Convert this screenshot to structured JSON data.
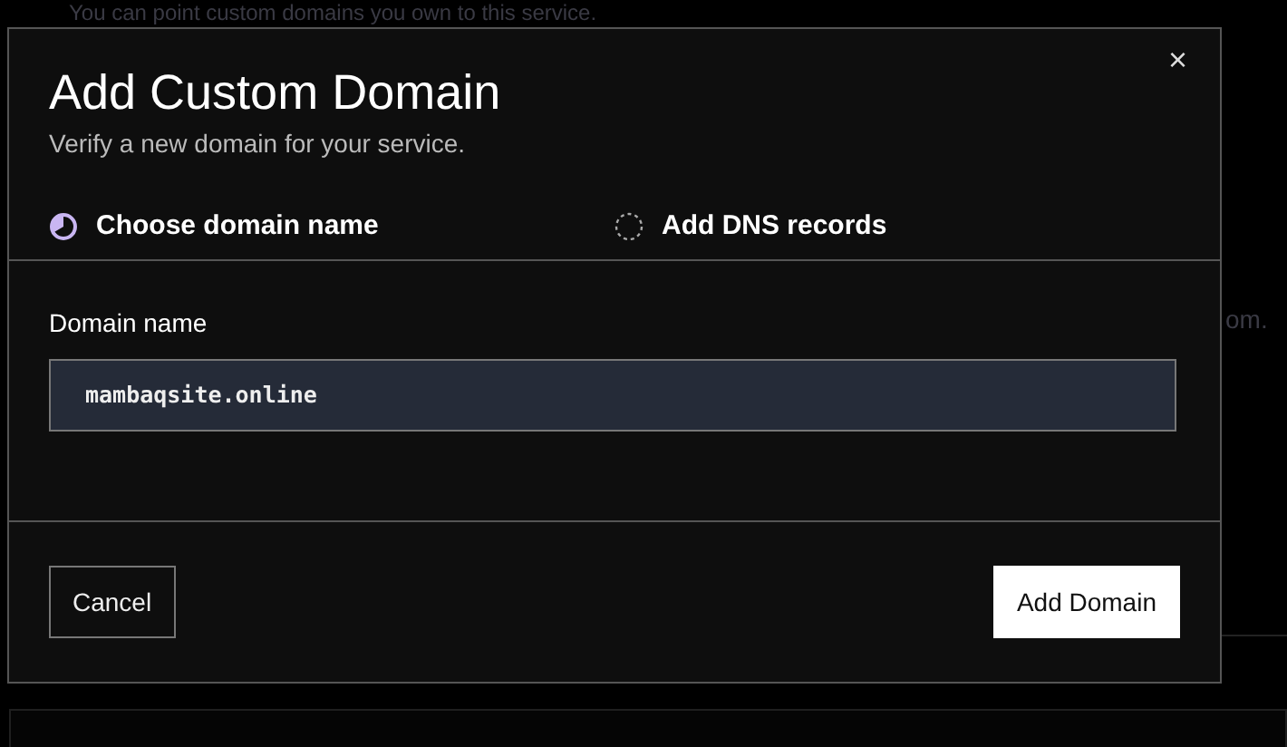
{
  "background": {
    "texts": [
      "You can point custom domains you own to this service.",
      "om."
    ]
  },
  "dialog": {
    "close": "×",
    "title": "Add Custom Domain",
    "subtitle": "Verify a new domain for your service.",
    "steps": [
      {
        "label": "Choose domain name",
        "selected": true
      },
      {
        "label": "Add DNS records",
        "selected": false
      }
    ],
    "field": {
      "label": "Domain name",
      "value": "mambaqsite.online"
    },
    "buttons": [
      {
        "label": "Cancel",
        "kind": "secondary"
      },
      {
        "label": "Add Domain",
        "kind": "primary"
      }
    ]
  }
}
